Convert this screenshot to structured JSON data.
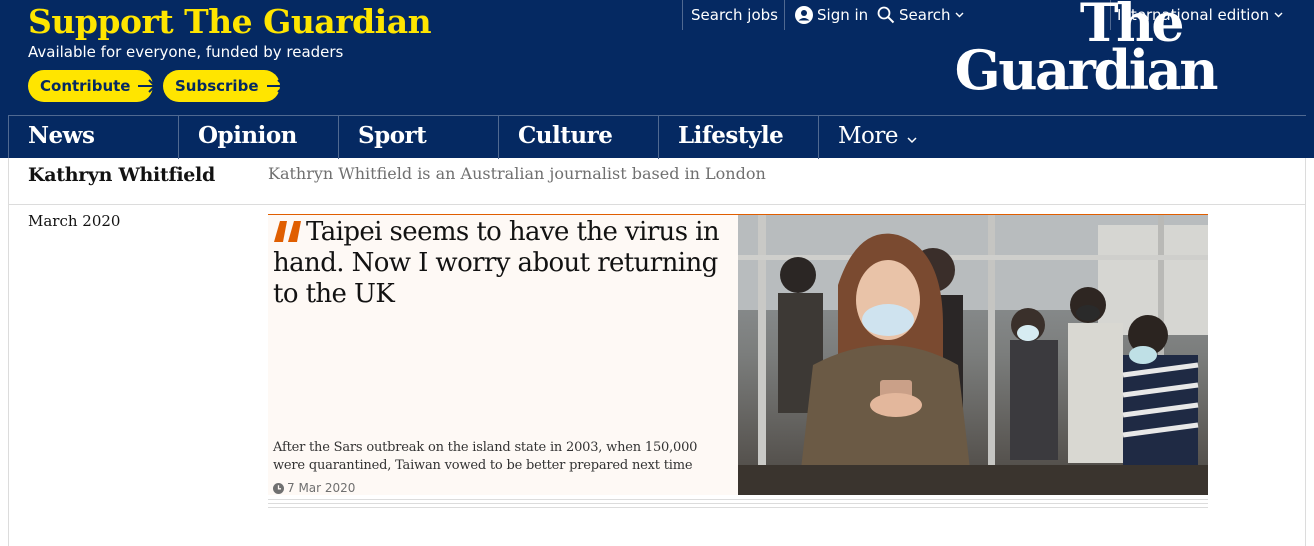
{
  "support": {
    "title": "Support The Guardian",
    "subtitle": "Available for everyone, funded by readers",
    "contribute_label": "Contribute",
    "subscribe_label": "Subscribe"
  },
  "header": {
    "search_jobs": "Search jobs",
    "sign_in": "Sign in",
    "search": "Search",
    "edition": "International edition",
    "logo_line1": "The",
    "logo_line2": "Guardian"
  },
  "nav": {
    "items": [
      "News",
      "Opinion",
      "Sport",
      "Culture",
      "Lifestyle"
    ],
    "more": "More"
  },
  "author": {
    "name": "Kathryn Whitfield",
    "bio": "Kathryn Whitfield is an Australian journalist based in London"
  },
  "archive": {
    "date_heading": "March 2020",
    "card": {
      "headline": "Taipei seems to have the virus in hand. Now I worry about returning to the UK",
      "standfirst": "After the Sars outbreak on the island state in 2003, when 150,000 were quarantined, Taiwan vowed to be better prepared next time",
      "date": "7 Mar 2020",
      "image_icon": "photo-subway-passengers-masks"
    }
  },
  "colors": {
    "brand_blue": "#052962",
    "brand_yellow": "#ffe500",
    "opinion_orange": "#e05e00",
    "opinion_bg": "#fef9f5"
  }
}
